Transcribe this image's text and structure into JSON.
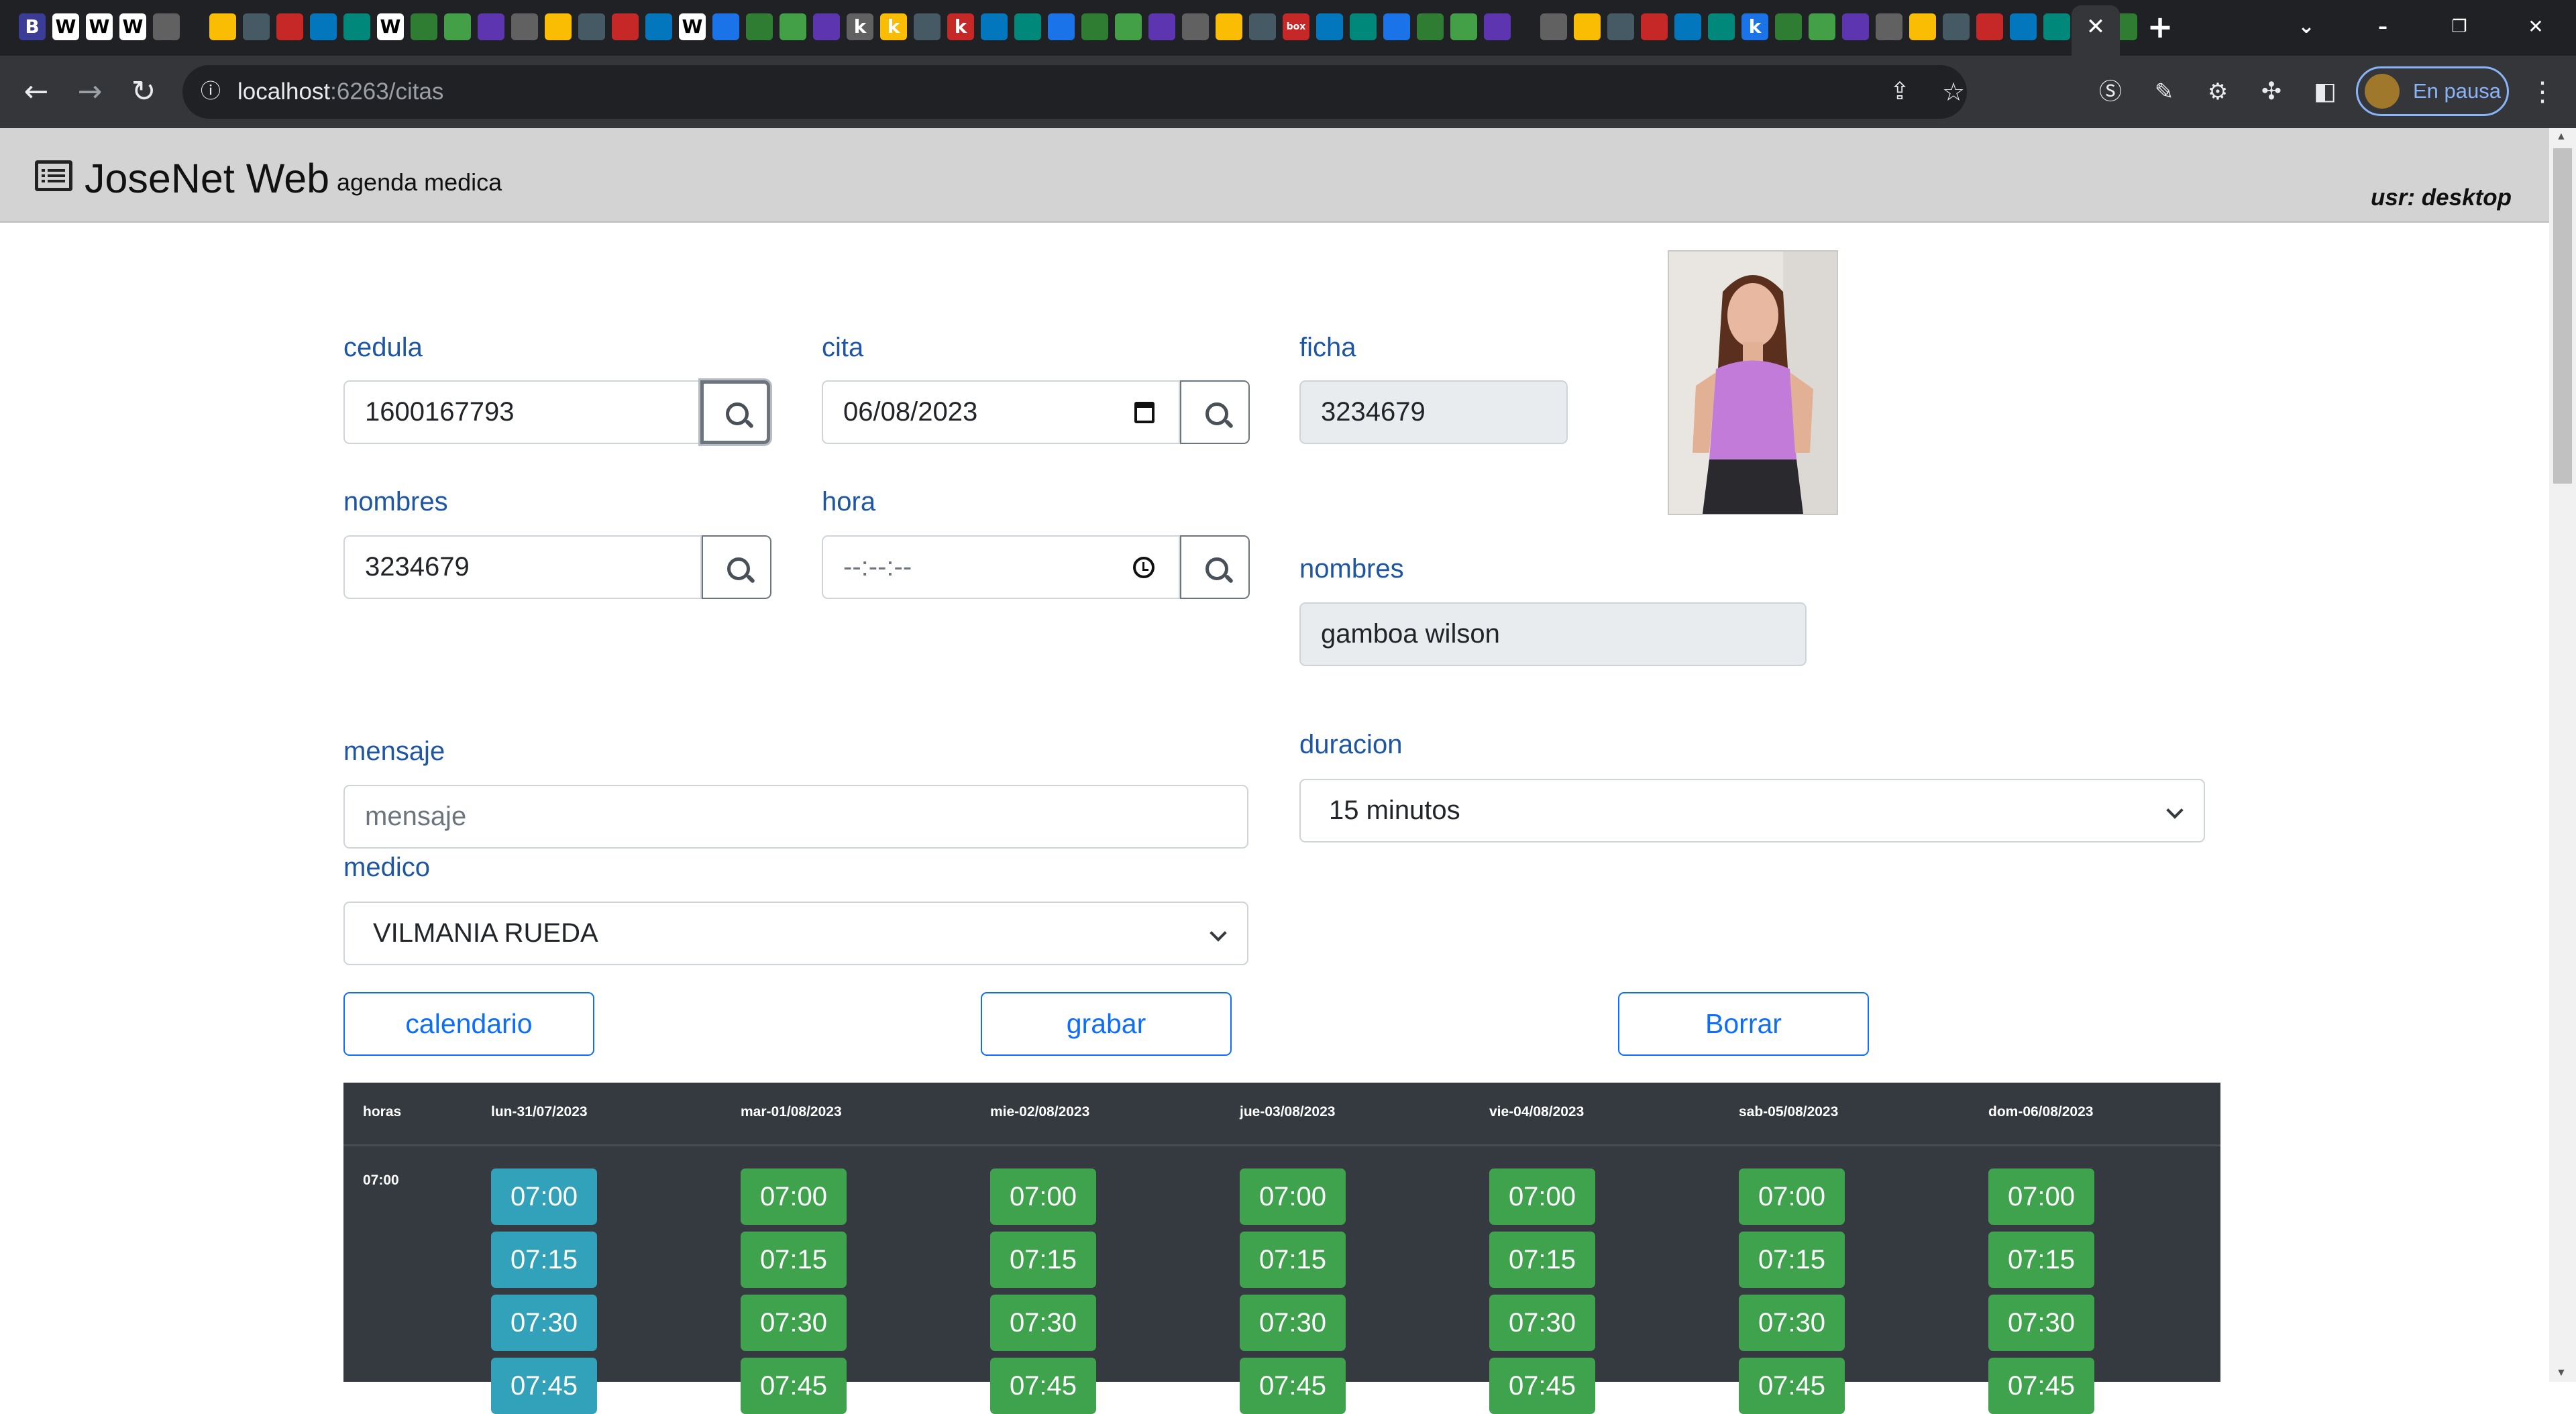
{
  "browser": {
    "url_host": "localhost",
    "url_path": ":6263/citas",
    "profile_status": "En pausa",
    "new_tab": "+",
    "tab_icons": [
      "B",
      "W",
      "W",
      "W",
      "",
      "",
      "",
      "",
      "",
      "",
      "W",
      "",
      "",
      "",
      "",
      "",
      "",
      "",
      "",
      "W",
      "",
      "",
      "",
      "",
      "k",
      "k",
      "",
      "k",
      "",
      "",
      "",
      "",
      "",
      "",
      "",
      "",
      "",
      "box",
      "",
      "",
      "",
      "",
      "",
      "",
      "",
      "",
      "",
      "",
      "",
      "",
      "k",
      "",
      "",
      "",
      "",
      "",
      "",
      "",
      "",
      "",
      "",
      ""
    ]
  },
  "app": {
    "title": "JoseNet Web",
    "subtitle": "agenda medica",
    "user": "usr: desktop"
  },
  "form": {
    "cedula": {
      "label": "cedula",
      "value": "1600167793"
    },
    "cita": {
      "label": "cita",
      "value": "06/08/2023"
    },
    "ficha": {
      "label": "ficha",
      "value": "3234679"
    },
    "nombres": {
      "label": "nombres",
      "value": "3234679"
    },
    "hora": {
      "label": "hora",
      "value": "--:--:--"
    },
    "patient_nombres": {
      "label": "nombres",
      "value": "gamboa wilson"
    },
    "mensaje": {
      "label": "mensaje",
      "placeholder": "mensaje"
    },
    "duracion": {
      "label": "duracion",
      "selected": "15 minutos"
    },
    "medico": {
      "label": "medico",
      "selected": "VILMANIA RUEDA"
    }
  },
  "actions": {
    "calendario": "calendario",
    "grabar": "grabar",
    "borrar": "Borrar"
  },
  "schedule": {
    "hours_header": "horas",
    "hour_row": "07:00",
    "days": [
      "lun-31/07/2023",
      "mar-01/08/2023",
      "mie-02/08/2023",
      "jue-03/08/2023",
      "vie-04/08/2023",
      "sab-05/08/2023",
      "dom-06/08/2023"
    ],
    "slots": [
      "07:00",
      "07:15",
      "07:30",
      "07:45"
    ],
    "selected_day_index": 0,
    "colors": {
      "available": "#3fa34d",
      "selected": "#31a2ba"
    }
  }
}
